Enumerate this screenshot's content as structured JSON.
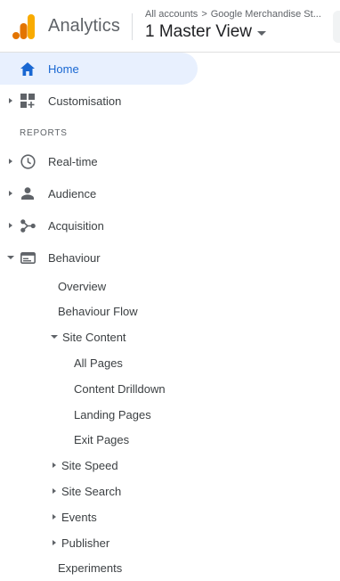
{
  "header": {
    "app_name": "Analytics",
    "breadcrumb_all": "All accounts",
    "breadcrumb_sep": ">",
    "breadcrumb_account": "Google Merchandise St...",
    "view_name": "1 Master View"
  },
  "colors": {
    "accent": "#1967d2",
    "active_bg": "#e8f0fe",
    "logo_orange": "#f9ab00",
    "logo_dark_orange": "#e37400"
  },
  "nav": {
    "home": {
      "label": "Home",
      "icon": "home-icon"
    },
    "customisation": {
      "label": "Customisation",
      "icon": "dashboard-icon"
    },
    "section_reports": "REPORTS",
    "realtime": {
      "label": "Real-time",
      "icon": "clock-icon"
    },
    "audience": {
      "label": "Audience",
      "icon": "person-icon"
    },
    "acquisition": {
      "label": "Acquisition",
      "icon": "acquisition-icon"
    },
    "behaviour": {
      "label": "Behaviour",
      "icon": "behaviour-icon"
    },
    "behaviour_children": {
      "overview": "Overview",
      "behaviour_flow": "Behaviour Flow",
      "site_content": "Site Content",
      "site_content_children": {
        "all_pages": "All Pages",
        "content_drilldown": "Content Drilldown",
        "landing_pages": "Landing Pages",
        "exit_pages": "Exit Pages"
      },
      "site_speed": "Site Speed",
      "site_search": "Site Search",
      "events": "Events",
      "publisher": "Publisher",
      "experiments": "Experiments"
    }
  }
}
